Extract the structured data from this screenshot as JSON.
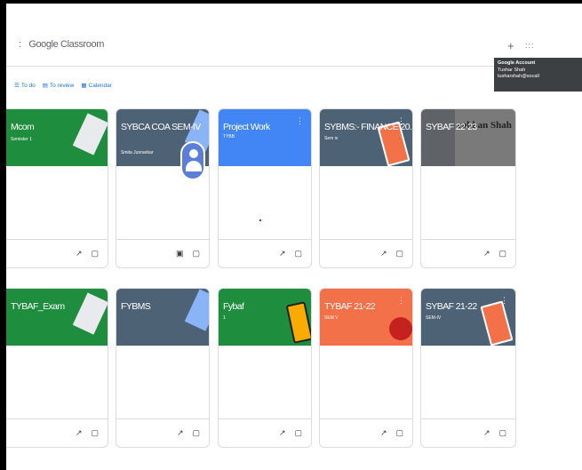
{
  "app": {
    "brand": "Google Classroom",
    "menu_glyph": ":",
    "plus_glyph": "+",
    "apps_glyph": ":::",
    "tooltip": {
      "title": "Google Account",
      "name": "Tushar Shah",
      "email": "tusharshah@socall"
    }
  },
  "subnav": [
    {
      "icon": "todo-icon",
      "glyph": "☰",
      "label": "To do"
    },
    {
      "icon": "review-icon",
      "glyph": "▤",
      "label": "To review"
    },
    {
      "icon": "calendar-icon",
      "glyph": "▦",
      "label": "Calendar"
    }
  ],
  "colors": {
    "green": "#1e8e3e",
    "slate": "#4e6275",
    "blue": "#4285f4",
    "orange": "#f27149",
    "gray": "#5f6368"
  },
  "courses": [
    {
      "title": "Mcom",
      "section": "Semister 1",
      "owner": "",
      "color": "#1e8e3e"
    },
    {
      "title": "SYBCA COA SEM-IV",
      "section": "",
      "owner": "Smita Junnarkar",
      "color": "#4e6275"
    },
    {
      "title": "Project Work",
      "section": "TYBB",
      "owner": "",
      "color": "#4285f4"
    },
    {
      "title": "SYBMS:- FINANCE 20...",
      "section": "Sem iv",
      "owner": "",
      "color": "#4e6275"
    },
    {
      "title": "SYBAF 22-23",
      "section": "",
      "owner": "",
      "color": "#5f6368",
      "logo_text": "rabhan Shah"
    },
    {
      "title": "TYBAF_Exam",
      "section": "",
      "owner": "",
      "color": "#1e8e3e"
    },
    {
      "title": "FYBMS",
      "section": "",
      "owner": "",
      "color": "#4e6275"
    },
    {
      "title": "Fybaf",
      "section": "1",
      "owner": "",
      "color": "#1e8e3e"
    },
    {
      "title": "TYBAF 21-22",
      "section": "SEM V",
      "owner": "",
      "color": "#f27149"
    },
    {
      "title": "SYBAF 21-22",
      "section": "SEM-IV",
      "owner": "",
      "color": "#4e6275"
    }
  ],
  "footer_icons": {
    "trend_glyph": "↗",
    "folder_glyph": "▢",
    "gradebook_glyph": "▣"
  }
}
